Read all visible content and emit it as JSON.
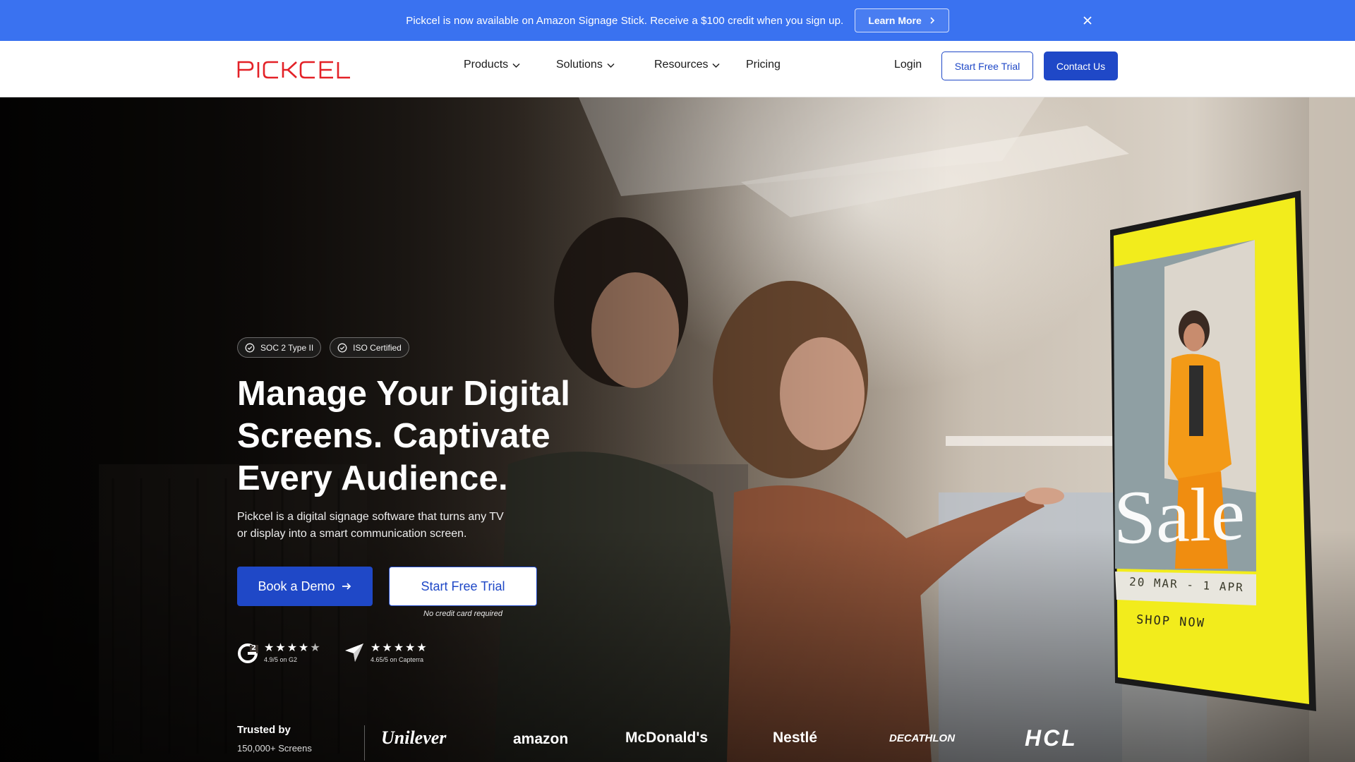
{
  "announcement": {
    "text": "Pickcel is now available on Amazon Signage Stick. Receive a $100 credit when you sign up.",
    "cta": "Learn More"
  },
  "nav": {
    "logo": "PICKCEL",
    "items": [
      {
        "label": "Products",
        "dropdown": true
      },
      {
        "label": "Solutions",
        "dropdown": true
      },
      {
        "label": "Resources",
        "dropdown": true
      },
      {
        "label": "Pricing",
        "dropdown": false
      }
    ],
    "login": "Login",
    "trial": "Start Free Trial",
    "contact": "Contact Us"
  },
  "hero": {
    "badges": [
      "SOC 2 Type II",
      "ISO Certified"
    ],
    "title_lines": [
      "Manage Your Digital",
      "Screens. Captivate",
      "Every Audience."
    ],
    "subtitle_lines": [
      "Pickcel is a digital signage software that turns any TV",
      "or display into a smart communication screen."
    ],
    "demo_button": "Book a Demo",
    "trial_button": "Start Free Trial",
    "no_credit_card": "No credit card required",
    "ratings": [
      {
        "source": "G2",
        "stars": 4.5,
        "caption": "4.9/5 on G2"
      },
      {
        "source": "Capterra",
        "stars": 5,
        "caption": "4.65/5 on Capterra"
      }
    ],
    "screen": {
      "sale": "Sale",
      "dates": "20 MAR - 1 APR",
      "shop": "SHOP NOW"
    }
  },
  "trusted": {
    "title": "Trusted by",
    "count": "150,000+ Screens",
    "brands": [
      "Unilever",
      "amazon",
      "McDonald's",
      "Nestlé",
      "DECATHLON",
      "HCL"
    ]
  },
  "colors": {
    "announce_bg": "#3a72f0",
    "primary": "#1f48c7",
    "logo_red": "#e32127",
    "screen_yellow": "#f2ec1c"
  }
}
